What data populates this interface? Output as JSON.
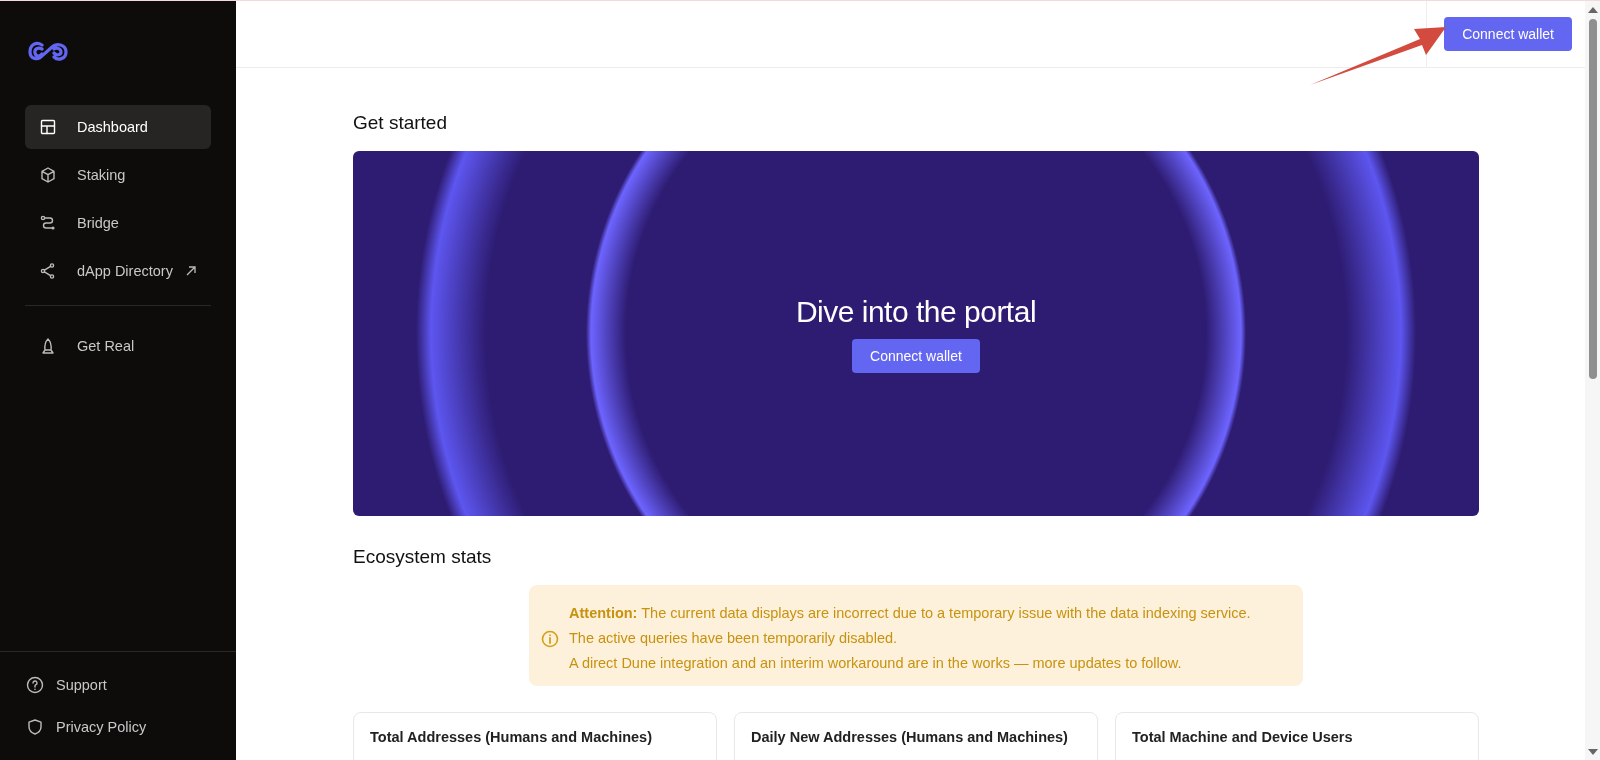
{
  "sidebar": {
    "nav_items": [
      {
        "label": "Dashboard",
        "selected": true,
        "external": false
      },
      {
        "label": "Staking",
        "selected": false,
        "external": false
      },
      {
        "label": "Bridge",
        "selected": false,
        "external": false
      },
      {
        "label": "dApp Directory",
        "selected": false,
        "external": true
      }
    ],
    "extra_items": [
      {
        "label": "Get Real",
        "selected": false
      }
    ],
    "footer_items": [
      {
        "label": "Support"
      },
      {
        "label": "Privacy Policy"
      }
    ]
  },
  "header": {
    "connect_button": "Connect wallet"
  },
  "get_started": {
    "title": "Get started",
    "banner_title": "Dive into the portal",
    "banner_button": "Connect wallet"
  },
  "ecosystem_stats": {
    "title": "Ecosystem stats",
    "alert": {
      "lines": [
        "**Attention:** The current data displays are incorrect due to a temporary issue with the data indexing service.",
        "The active queries have been temporarily disabled.",
        "A direct Dune integration and an interim workaround are in the works — more updates to follow."
      ]
    },
    "cards": [
      {
        "title": "Total Addresses (Humans and Machines)"
      },
      {
        "title": "Daily New Addresses (Humans and Machines)"
      },
      {
        "title": "Total Machine and Device Users"
      }
    ]
  }
}
